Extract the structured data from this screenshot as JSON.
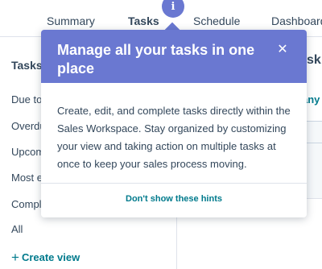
{
  "tabs": [
    {
      "label": "Summary",
      "active": false
    },
    {
      "label": "Tasks",
      "active": true
    },
    {
      "label": "Schedule",
      "active": false
    },
    {
      "label": "Dashboard",
      "active": false
    }
  ],
  "sidebar": {
    "heading": "Tasks",
    "views": [
      "Due to",
      "Overdu",
      "Upcom",
      "Most e",
      "Compl",
      "All"
    ],
    "create_view_label": "Create view",
    "create_view_icon": "plus-icon"
  },
  "content": {
    "title": "sk",
    "link": "any"
  },
  "info_badge": {
    "glyph": "i",
    "icon": "info-icon"
  },
  "popover": {
    "title": "Manage all your tasks in one place",
    "close_glyph": "✕",
    "body": "Create, edit, and complete tasks directly within the Sales Workspace. Stay organized by customizing your view and taking action on multiple tasks at once to keep your sales process moving.",
    "footer_link": "Don't show these hints"
  },
  "colors": {
    "accent": "#6a78d1",
    "link": "#007a8c",
    "text": "#33475b"
  }
}
